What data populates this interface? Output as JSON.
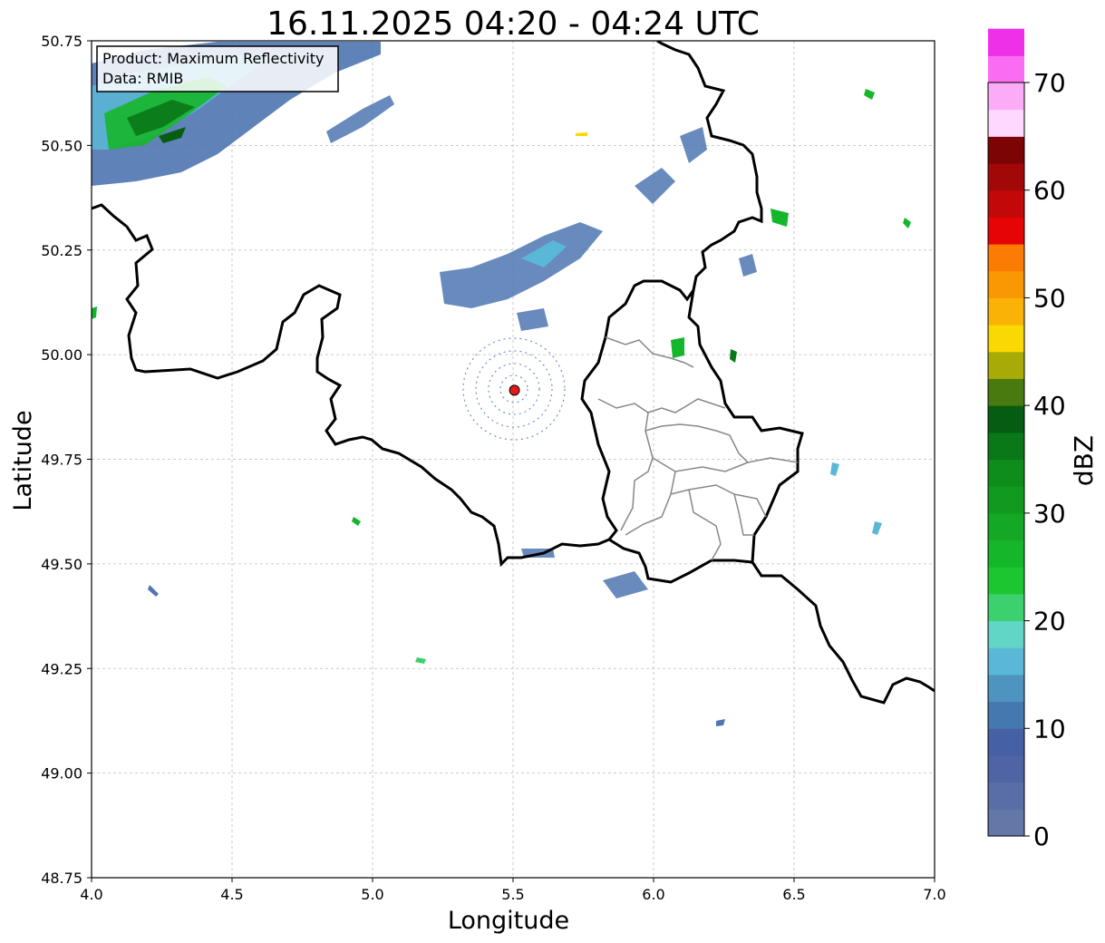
{
  "map": {
    "title": "16.11.2025 04:20 - 04:24 UTC",
    "xlabel": "Longitude",
    "ylabel": "Latitude",
    "annotation": {
      "product": "Product: Maximum Reflectivity",
      "data": "Data: RMIB"
    },
    "x_ticks": [
      "4.0",
      "4.5",
      "5.0",
      "5.5",
      "6.0",
      "6.5",
      "7.0"
    ],
    "y_ticks": [
      "50.75",
      "50.50",
      "50.25",
      "50.00",
      "49.75",
      "49.50",
      "49.25",
      "49.00",
      "48.75"
    ],
    "xlim": [
      4.0,
      7.0
    ],
    "ylim": [
      48.75,
      50.75
    ],
    "grid": true,
    "radar_site": {
      "lon": 5.505,
      "lat": 49.915,
      "color": "#e31a1c"
    },
    "colorbar": {
      "label": "dBZ",
      "ticks": [
        "0",
        "10",
        "20",
        "30",
        "40",
        "50",
        "60",
        "70"
      ],
      "range": [
        0,
        70
      ],
      "step": 2.5,
      "colors": [
        "#6478a8",
        "#5a6ea6",
        "#4f64a4",
        "#4660a6",
        "#4678b0",
        "#4e94c0",
        "#5ab8d6",
        "#62d6c6",
        "#3cd06e",
        "#1cc630",
        "#16b62a",
        "#14a824",
        "#129a20",
        "#0e8c1c",
        "#0a7818",
        "#065c10",
        "#487a10",
        "#a8aa08",
        "#fad802",
        "#fab206",
        "#fa9804",
        "#fa7c04",
        "#e60406",
        "#c20808",
        "#a20808",
        "#7c0404",
        "#fed8fe",
        "#fcacf6",
        "#fa6cf2",
        "#ee30e8"
      ]
    },
    "legend_position": "top-left"
  }
}
